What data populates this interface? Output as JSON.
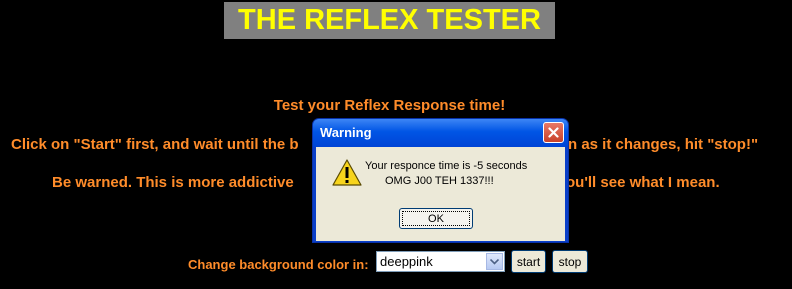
{
  "page": {
    "title": "THE REFLEX TESTER",
    "intro_line1": "Test your Reflex Response time!",
    "intro_line2_left": "Click on \"Start\" first, and wait until the b",
    "intro_line2_right": "n as it changes, hit \"stop!\"",
    "intro_line3_left": "Be warned. This is more addictive",
    "intro_line3_right": "ou'll see what I mean.",
    "colors": {
      "background": "#000000",
      "title_bg": "#808080",
      "title_text": "#FFFF00",
      "orange_text": "#FF8C2A"
    }
  },
  "controls": {
    "label": "Change background color in:",
    "color_select": {
      "value": "deeppink"
    },
    "start_label": "start",
    "stop_label": "stop"
  },
  "dialog": {
    "title": "Warning",
    "message_line1": "Your responce time is -5 seconds",
    "message_line2": "OMG J00 TEH 1337!!!",
    "ok_label": "OK",
    "icon": "warning-icon",
    "close_icon": "close-icon"
  }
}
